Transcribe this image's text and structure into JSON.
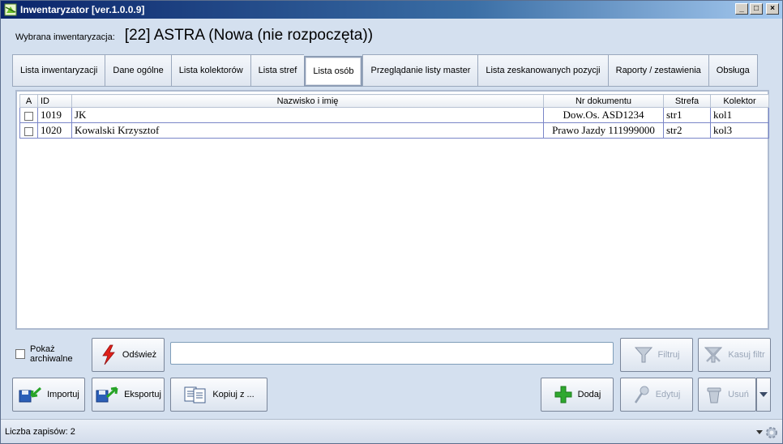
{
  "window": {
    "title": "Inwentaryzator [ver.1.0.0.9]"
  },
  "header": {
    "selected_label": "Wybrana inwentaryzacja:",
    "selected_value": "[22] ASTRA (Nowa (nie rozpoczęta))"
  },
  "tabs": [
    {
      "label": "Lista inwentaryzacji"
    },
    {
      "label": "Dane ogólne"
    },
    {
      "label": "Lista kolektorów"
    },
    {
      "label": "Lista stref"
    },
    {
      "label": "Lista osób",
      "active": true
    },
    {
      "label": "Przeglądanie listy master"
    },
    {
      "label": "Lista zeskanowanych pozycji"
    },
    {
      "label": "Raporty / zestawienia"
    },
    {
      "label": "Obsługa"
    }
  ],
  "grid": {
    "columns": [
      "A",
      "ID",
      "Nazwisko i imię",
      "Nr dokumentu",
      "Strefa",
      "Kolektor"
    ],
    "rows": [
      {
        "id": "1019",
        "name": "JK",
        "doc": "Dow.Os. ASD1234",
        "zone": "str1",
        "collector": "kol1"
      },
      {
        "id": "1020",
        "name": "Kowalski Krzysztof",
        "doc": "Prawo Jazdy 111999000",
        "zone": "str2",
        "collector": "kol3"
      }
    ]
  },
  "controls": {
    "archive_label_1": "Pokaż",
    "archive_label_2": "archiwalne",
    "refresh": "Odśwież",
    "filter_value": "",
    "filter": "Filtruj",
    "clear_filter": "Kasuj filtr",
    "import": "Importuj",
    "export": "Eksportuj",
    "copy_from": "Kopiuj z ...",
    "add": "Dodaj",
    "edit": "Edytuj",
    "delete": "Usuń"
  },
  "status": {
    "record_count": "Liczba zapisów: 2"
  },
  "colors": {
    "title_bar": "#0a246a",
    "add_icon": "#2fa82f",
    "refresh_icon": "#e0201a"
  }
}
